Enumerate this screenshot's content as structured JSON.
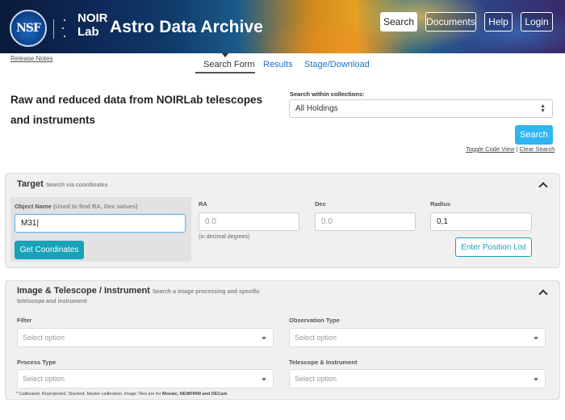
{
  "header": {
    "nsf_text": "NSF",
    "noir_line1": "NOIR",
    "noir_line2": "Lab",
    "title": "Astro Data Archive",
    "buttons": [
      "Search",
      "Documents",
      "Help",
      "Login"
    ]
  },
  "release_notes": "Release Notes",
  "tabs": [
    "Search Form",
    "Results",
    "Stage/Download"
  ],
  "headline": "Raw and reduced data from NOIRLab telescopes and instruments",
  "collections": {
    "label": "Search within collections:",
    "value": "All Holdings"
  },
  "search_button": "Search",
  "links": {
    "toggle": "Toggle Code View",
    "separator": "|",
    "clear": "Clear Search"
  },
  "target": {
    "title": "Target",
    "subtitle": "Search via coordinates",
    "object_label": "Object Name",
    "object_hint": "(Used to find RA, Dec values)",
    "object_value": "M31",
    "get_coords": "Get Coordinates",
    "ra_label": "RA",
    "ra_placeholder": "0.0",
    "ra_note": "(in decimal degrees)",
    "dec_label": "Dec",
    "dec_placeholder": "0.0",
    "radius_label": "Radius",
    "radius_value": "0,1",
    "enter_position": "Enter Position List"
  },
  "image_panel": {
    "title": "Image & Telescope / Instrument",
    "subtitle": "Search a image processing and specific telelscope and instrument",
    "filter_label": "Filter",
    "obs_label": "Observation Type",
    "process_label": "Process Type",
    "telescope_label": "Telescope & Instrument",
    "placeholder": "Select option",
    "footnote_prefix": "* Calibrated, Reprojected, Stacked, Master calibration, Image Tiles are for",
    "footnote_bold": "Mosaic, NEWFIRM and DECam"
  },
  "colors": {
    "accent": "#2eb6f0",
    "teal": "#17a2b8",
    "link": "#1a73c8"
  }
}
